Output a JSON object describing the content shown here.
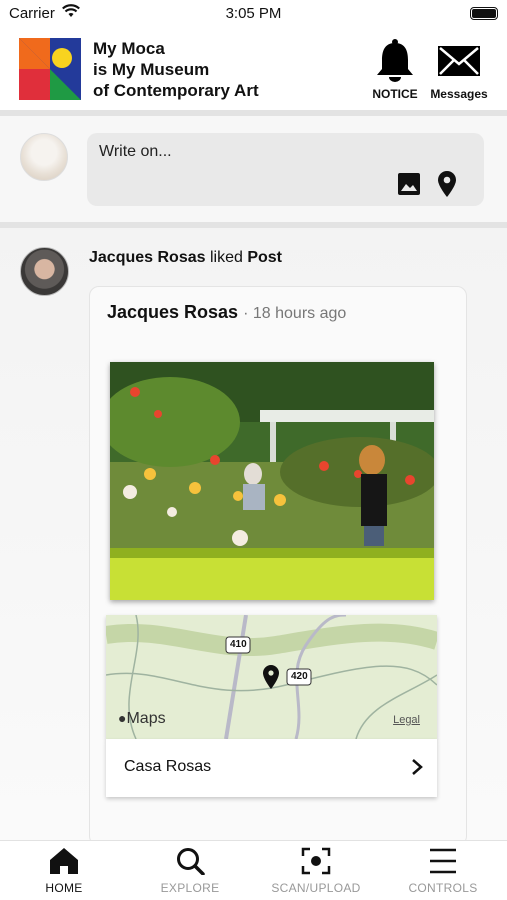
{
  "status": {
    "carrier": "Carrier",
    "time": "3:05 PM"
  },
  "header": {
    "brand_line1": "My Moca",
    "brand_line2": "is My Museum",
    "brand_line3": "of Contemporary Art",
    "notice_label": "NOTICE",
    "messages_label": "Messages",
    "logo_colors": {
      "blue": "#233a9a",
      "orange": "#f06a1c",
      "yellow": "#f8d31f",
      "red": "#e02f3b",
      "green": "#1f9a44"
    }
  },
  "composer": {
    "placeholder": "Write on...",
    "icons": [
      "image-icon",
      "location-pin-icon"
    ]
  },
  "activity": {
    "user": "Jacques Rosas",
    "verb": "liked",
    "object": "Post"
  },
  "post": {
    "author": "Jacques Rosas",
    "timestamp": "18 hours ago",
    "location": {
      "name": "Casa Rosas",
      "maps_label": "Maps",
      "legal_label": "Legal",
      "road_labels": [
        "410",
        "420"
      ]
    }
  },
  "post_actions": [
    "heart-icon",
    "comment-icon",
    "share-icon"
  ],
  "tabs": [
    {
      "label": "HOME",
      "icon": "home-icon",
      "active": true
    },
    {
      "label": "EXPLORE",
      "icon": "search-icon",
      "active": false
    },
    {
      "label": "SCAN/UPLOAD",
      "icon": "scan-icon",
      "active": false
    },
    {
      "label": "CONTROLS",
      "icon": "menu-icon",
      "active": false
    }
  ]
}
